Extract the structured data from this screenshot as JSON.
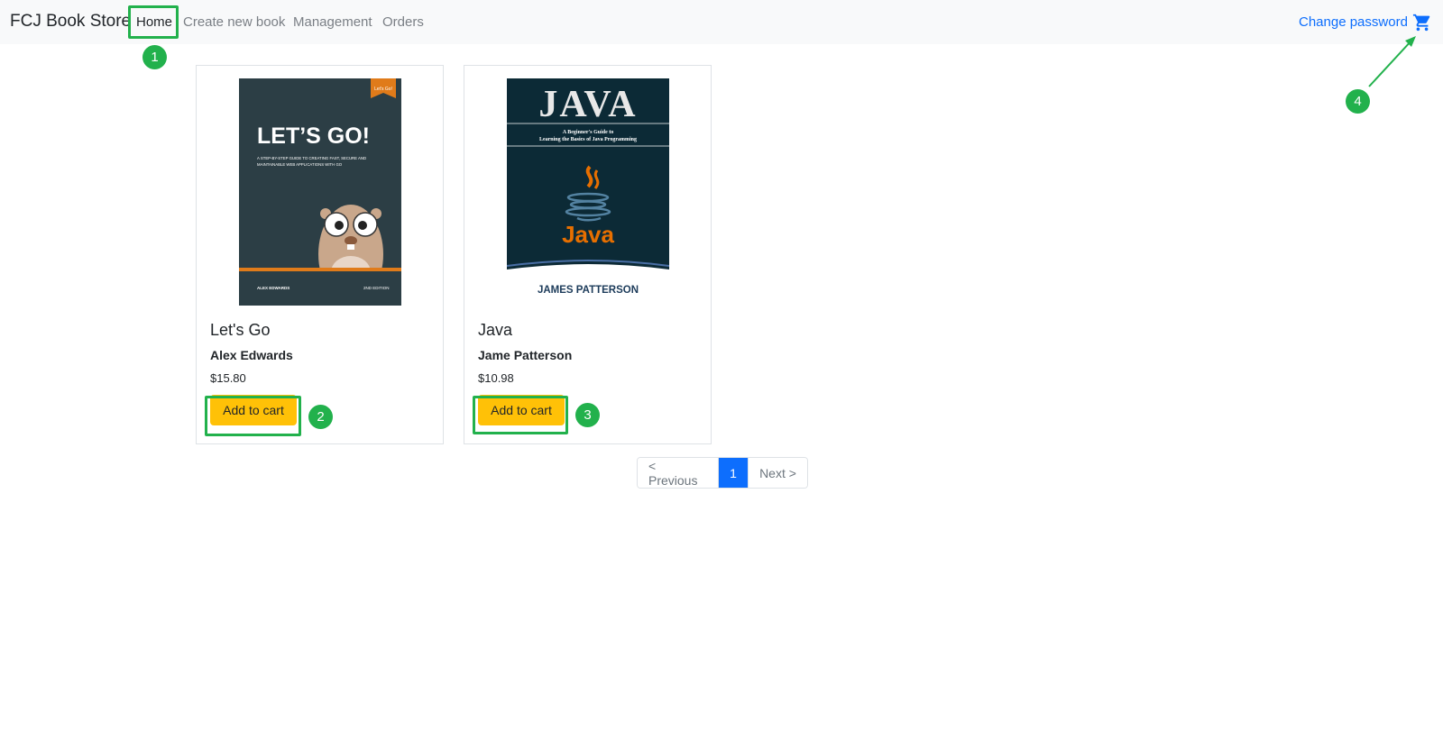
{
  "navbar": {
    "brand": "FCJ Book Store",
    "links": [
      {
        "label": "Home"
      },
      {
        "label": "Create new book"
      },
      {
        "label": "Management"
      },
      {
        "label": "Orders"
      }
    ],
    "change_password": "Change password",
    "cart_icon": "shopping-cart-icon"
  },
  "books": [
    {
      "title": "Let's Go",
      "author": "Alex Edwards",
      "price": "$15.80",
      "button": "Add to cart",
      "cover": {
        "tag": "Let's Go!",
        "heading": "LET’S GO!",
        "subtitle_line1": "A STEP-BY-STEP GUIDE TO CREATING FAST, SECURE AND",
        "subtitle_line2": "MAINTAINABLE WEB APPLICATIONS WITH GO",
        "author": "ALEX EDWARDS",
        "edition": "2ND EDITION"
      }
    },
    {
      "title": "Java",
      "author": "Jame Patterson",
      "price": "$10.98",
      "button": "Add to cart",
      "cover": {
        "heading": "JAVA",
        "subtitle_line1": "A Beginner's Guide to",
        "subtitle_line2": "Learning the Basics of Java Programming",
        "logo_text": "Java",
        "author": "JAMES PATTERSON"
      }
    }
  ],
  "pagination": {
    "previous": "< Previous",
    "current": "1",
    "next": "Next >"
  },
  "annotations": [
    "1",
    "2",
    "3",
    "4"
  ],
  "colors": {
    "accent": "#0d6efd",
    "button": "#ffc107",
    "annotation": "#22b14c"
  }
}
